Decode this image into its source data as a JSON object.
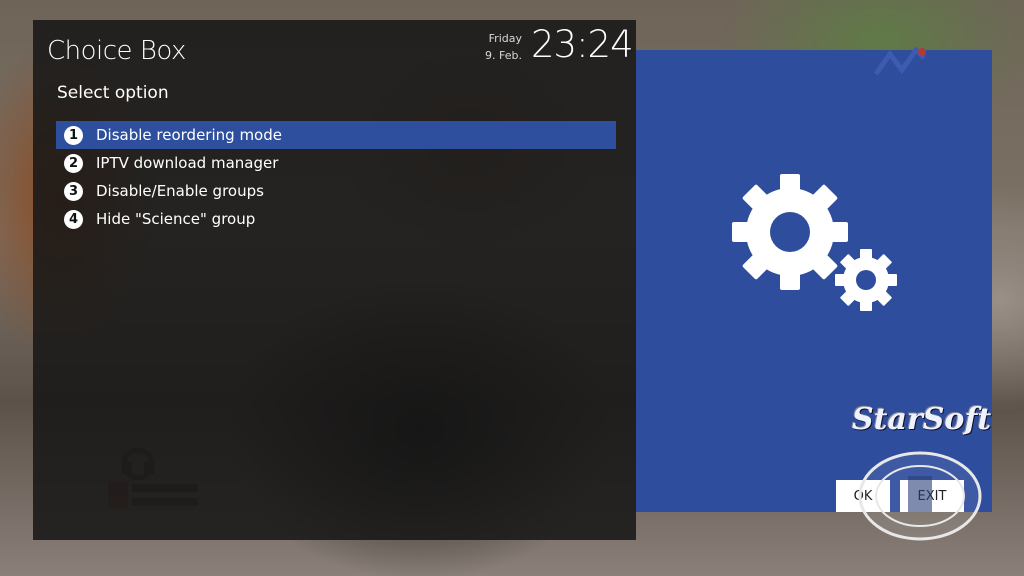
{
  "dialog": {
    "title": "Choice Box",
    "subtitle": "Select option",
    "date_day": "Friday",
    "date_date": "9. Feb.",
    "clock": "23:24"
  },
  "menu": {
    "items": [
      {
        "num": "1",
        "label": "Disable reordering mode",
        "selected": true
      },
      {
        "num": "2",
        "label": "IPTV download manager",
        "selected": false
      },
      {
        "num": "3",
        "label": "Disable/Enable groups",
        "selected": false
      },
      {
        "num": "4",
        "label": "Hide \"Science\" group",
        "selected": false
      }
    ]
  },
  "buttons": {
    "ok_label": "OK",
    "exit_label": "EXIT"
  },
  "watermark": {
    "brand": "StarSoft"
  },
  "icons": {
    "settings": "gears-icon",
    "channel": "tv-channel-logo"
  },
  "colors": {
    "selection": "#2e4f9e",
    "right_panel": "#2f4d9d",
    "panel_bg": "#161616"
  }
}
